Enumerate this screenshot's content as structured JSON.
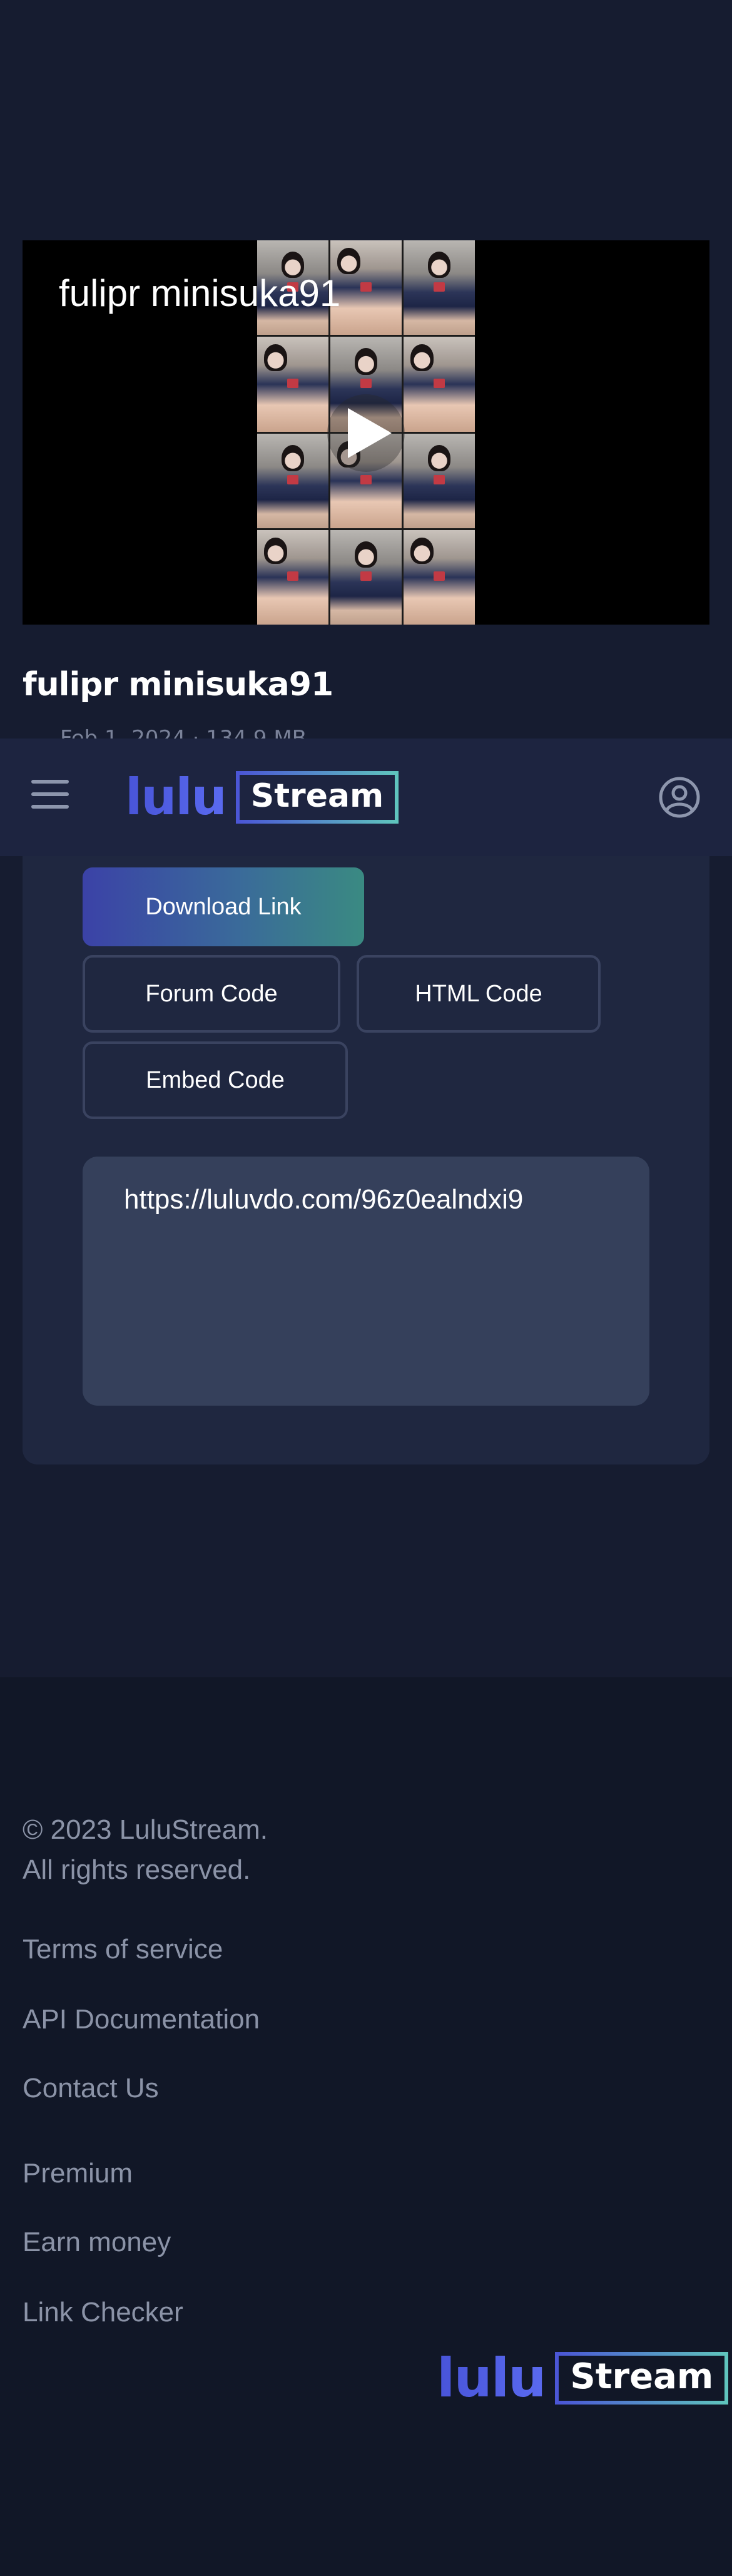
{
  "player": {
    "title_overlay": "fulipr minisuka91",
    "play_icon": "play-icon"
  },
  "video": {
    "title": "fulipr minisuka91",
    "meta": "Feb 1, 2024  ·  134.9 MB"
  },
  "header": {
    "menu_icon": "hamburger-menu-icon",
    "logo_part1": "lulu",
    "logo_part2": "Stream",
    "account_icon": "user-circle-icon"
  },
  "share": {
    "download_label": "Download Link",
    "forum_label": "Forum Code",
    "html_label": "HTML Code",
    "embed_label": "Embed Code",
    "link_value": "https://luluvdo.com/96z0ealndxi9"
  },
  "footer": {
    "copyright_line1": "© 2023 LuluStream.",
    "copyright_line2": "All rights reserved.",
    "links": [
      "Terms of service",
      "API Documentation",
      "Contact Us",
      "Premium",
      "Earn money",
      "Link Checker"
    ],
    "logo_part1": "lulu",
    "logo_part2": "Stream"
  },
  "colors": {
    "background": "#161c30",
    "header": "#1d2440",
    "card": "#1f2740",
    "footer": "#111727",
    "accent_blue": "#4854d8",
    "accent_teal": "#5fc4bd"
  }
}
